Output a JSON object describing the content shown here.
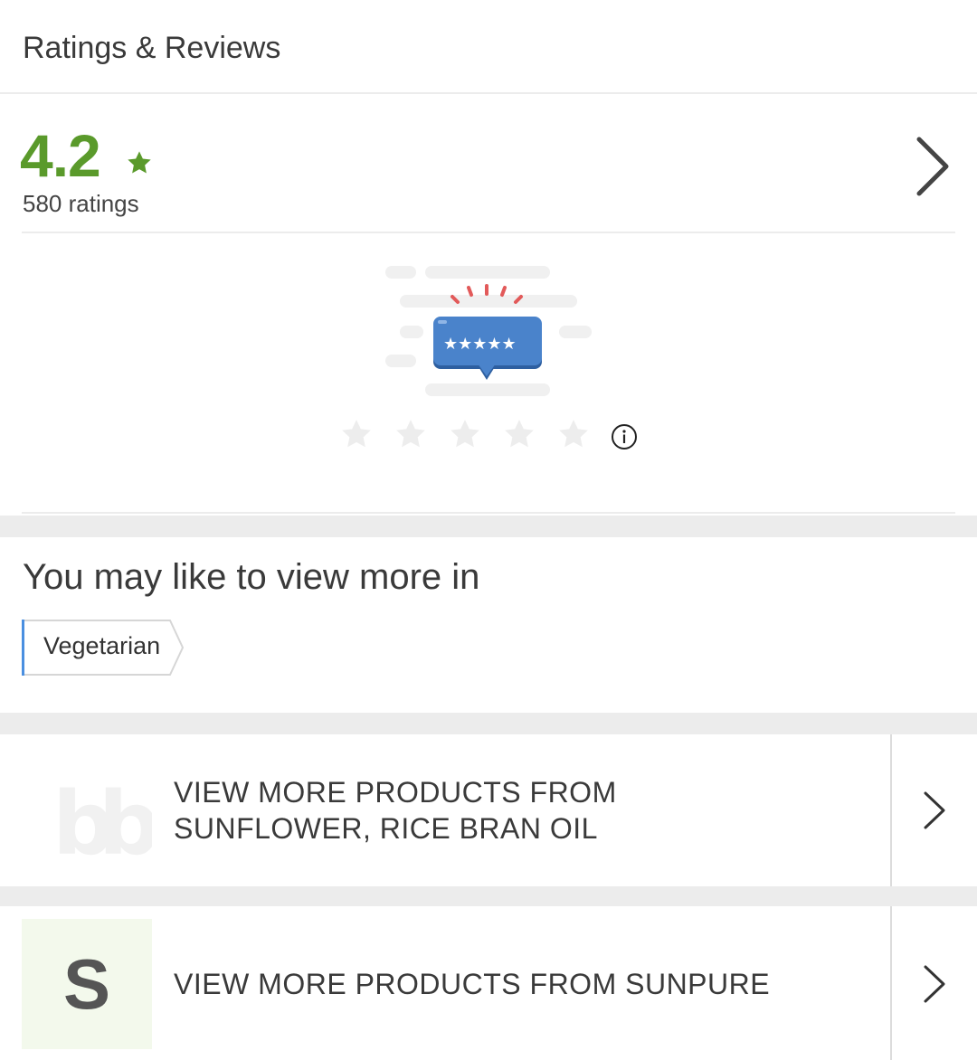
{
  "header": {
    "title": "Ratings & Reviews"
  },
  "rating": {
    "value": "4.2",
    "count_label": "580 ratings",
    "accent_color": "#5a9a2b",
    "star_icon": "star-icon",
    "chevron_icon": "chevron-right-icon"
  },
  "rate_widget": {
    "stars": 5,
    "selected": 0,
    "info_icon": "info-icon"
  },
  "view_more": {
    "title": "You may like to view more in",
    "tags": [
      {
        "label": "Vegetarian"
      }
    ]
  },
  "brand_rows": [
    {
      "logo": "bb-logo-icon",
      "label": "VIEW MORE PRODUCTS FROM SUNFLOWER, RICE BRAN OIL",
      "line1": "VIEW MORE PRODUCTS FROM",
      "line2": "SUNFLOWER, RICE BRAN OIL"
    },
    {
      "logo_letter": "S",
      "label": "VIEW MORE PRODUCTS FROM SUNPURE"
    }
  ]
}
